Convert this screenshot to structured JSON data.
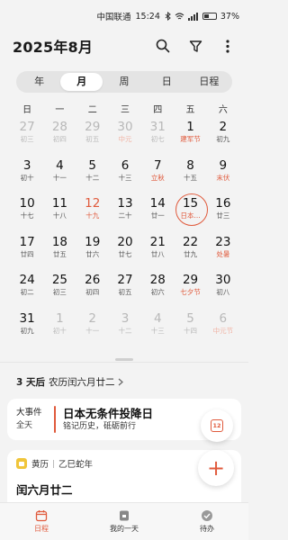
{
  "status_bar": {
    "carrier": "中国联通",
    "time": "15:24",
    "battery": "37%"
  },
  "header": {
    "title": "2025年8月"
  },
  "view_tabs": [
    {
      "label": "年",
      "active": false
    },
    {
      "label": "月",
      "active": true
    },
    {
      "label": "周",
      "active": false
    },
    {
      "label": "日",
      "active": false
    },
    {
      "label": "日程",
      "active": false
    }
  ],
  "weekdays": [
    "日",
    "一",
    "二",
    "三",
    "四",
    "五",
    "六"
  ],
  "weeks": [
    [
      {
        "d": "27",
        "l": "初三",
        "o": true
      },
      {
        "d": "28",
        "l": "初四",
        "o": true
      },
      {
        "d": "29",
        "l": "初五",
        "o": true
      },
      {
        "d": "30",
        "l": "中元",
        "o": true,
        "h": true
      },
      {
        "d": "31",
        "l": "初七",
        "o": true
      },
      {
        "d": "1",
        "l": "建军节",
        "h": true
      },
      {
        "d": "2",
        "l": "初九"
      }
    ],
    [
      {
        "d": "3",
        "l": "初十"
      },
      {
        "d": "4",
        "l": "十一"
      },
      {
        "d": "5",
        "l": "十二"
      },
      {
        "d": "6",
        "l": "十三"
      },
      {
        "d": "7",
        "l": "立秋",
        "h": true
      },
      {
        "d": "8",
        "l": "十五"
      },
      {
        "d": "9",
        "l": "末伏",
        "h": true
      }
    ],
    [
      {
        "d": "10",
        "l": "十七"
      },
      {
        "d": "11",
        "l": "十八"
      },
      {
        "d": "12",
        "l": "十九",
        "r": true,
        "h": true
      },
      {
        "d": "13",
        "l": "二十"
      },
      {
        "d": "14",
        "l": "廿一"
      },
      {
        "d": "15",
        "l": "日本...",
        "s": true,
        "h": true
      },
      {
        "d": "16",
        "l": "廿三"
      }
    ],
    [
      {
        "d": "17",
        "l": "廿四"
      },
      {
        "d": "18",
        "l": "廿五"
      },
      {
        "d": "19",
        "l": "廿六"
      },
      {
        "d": "20",
        "l": "廿七"
      },
      {
        "d": "21",
        "l": "廿八"
      },
      {
        "d": "22",
        "l": "廿九"
      },
      {
        "d": "23",
        "l": "处暑",
        "h": true
      }
    ],
    [
      {
        "d": "24",
        "l": "初二"
      },
      {
        "d": "25",
        "l": "初三"
      },
      {
        "d": "26",
        "l": "初四"
      },
      {
        "d": "27",
        "l": "初五"
      },
      {
        "d": "28",
        "l": "初六"
      },
      {
        "d": "29",
        "l": "七夕节",
        "h": true
      },
      {
        "d": "30",
        "l": "初八"
      }
    ],
    [
      {
        "d": "31",
        "l": "初九"
      },
      {
        "d": "1",
        "l": "初十",
        "o": true
      },
      {
        "d": "2",
        "l": "十一",
        "o": true
      },
      {
        "d": "3",
        "l": "十二",
        "o": true
      },
      {
        "d": "4",
        "l": "十三",
        "o": true
      },
      {
        "d": "5",
        "l": "十四",
        "o": true
      },
      {
        "d": "6",
        "l": "中元节",
        "o": true,
        "h": true
      }
    ]
  ],
  "info": {
    "days": "3 天后",
    "lunar": "农历闰六月廿二"
  },
  "event_card": {
    "kind": "大事件",
    "allday": "全天",
    "title": "日本无条件投降日",
    "subtitle": "铭记历史，砥砺前行"
  },
  "huangli_card": {
    "label": "黄历",
    "year": "乙巳蛇年",
    "lunar_date": "闰六月廿二"
  },
  "fab_cal_day": "12",
  "bottom_nav": [
    {
      "label": "日程",
      "active": true
    },
    {
      "label": "我的一天",
      "active": false
    },
    {
      "label": "待办",
      "active": false
    }
  ],
  "colors": {
    "accent": "#e05a3c",
    "background": "#f3f3f3"
  }
}
